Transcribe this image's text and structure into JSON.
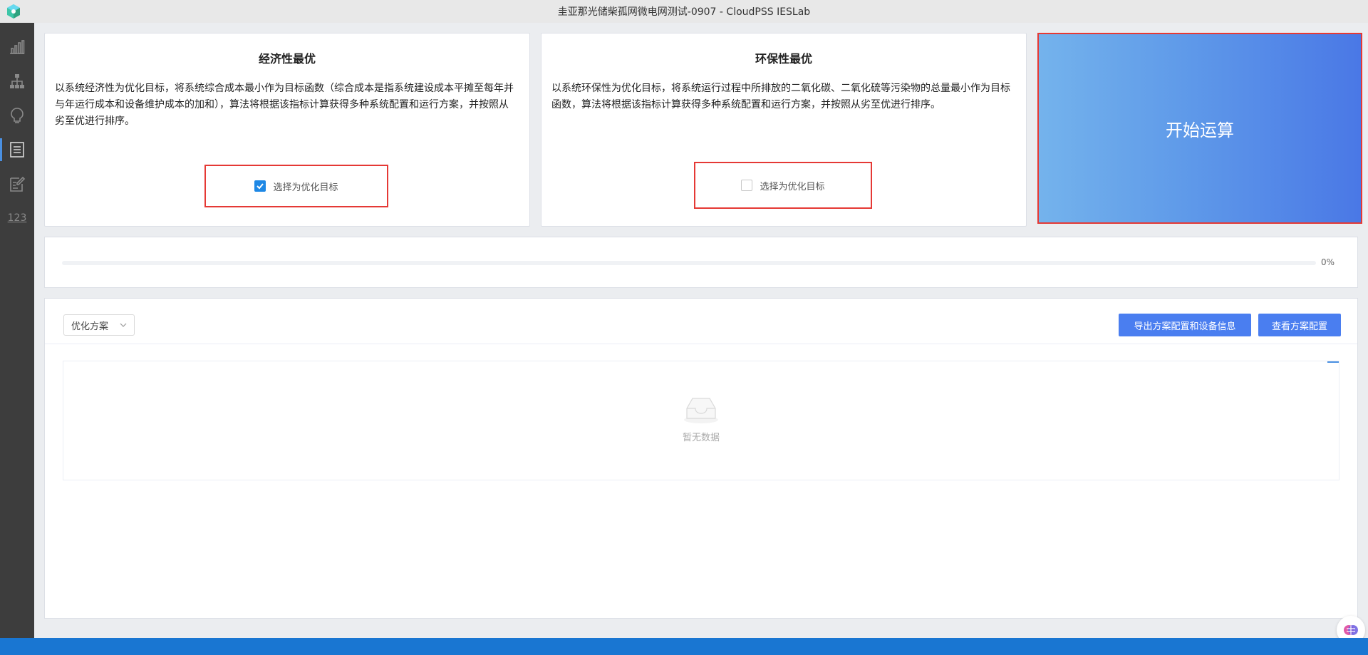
{
  "window": {
    "title": "圭亚那光储柴孤网微电网测试-0907 - CloudPSS IESLab"
  },
  "sidebar": {
    "items": [
      {
        "name": "bar-chart-icon",
        "active": false
      },
      {
        "name": "org-chart-icon",
        "active": false
      },
      {
        "name": "lightbulb-icon",
        "active": false
      },
      {
        "name": "list-doc-icon",
        "active": true
      },
      {
        "name": "edit-doc-icon",
        "active": false
      },
      {
        "name": "numeric-icon",
        "label": "123",
        "active": false
      }
    ]
  },
  "cards": {
    "economic": {
      "title": "经济性最优",
      "description": "以系统经济性为优化目标，将系统综合成本最小作为目标函数（综合成本是指系统建设成本平摊至每年并与年运行成本和设备维护成本的加和），算法将根据该指标计算获得多种系统配置和运行方案，并按照从劣至优进行排序。",
      "checkbox_label": "选择为优化目标",
      "checked": true
    },
    "environmental": {
      "title": "环保性最优",
      "description": "以系统环保性为优化目标，将系统运行过程中所排放的二氧化碳、二氧化硫等污染物的总量最小作为目标函数，算法将根据该指标计算获得多种系统配置和运行方案，并按照从劣至优进行排序。",
      "checkbox_label": "选择为优化目标",
      "checked": false
    }
  },
  "start_button": {
    "label": "开始运算"
  },
  "progress": {
    "value": 0,
    "text": "0%"
  },
  "results": {
    "select_value": "优化方案",
    "export_button": "导出方案配置和设备信息",
    "view_button": "查看方案配置",
    "empty_text": "暂无数据"
  },
  "colors": {
    "accent": "#4a7ef0",
    "highlight": "#e53935",
    "sidebar_bg": "#3d3d3d",
    "status_bar": "#1976d2"
  }
}
